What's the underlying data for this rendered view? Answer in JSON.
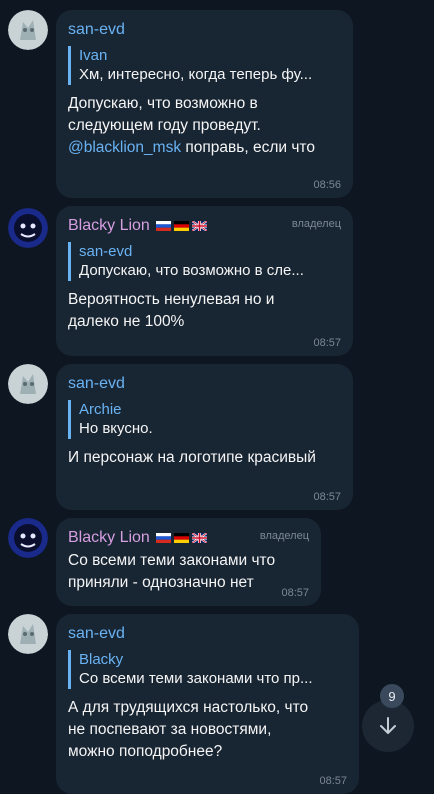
{
  "messages": [
    {
      "sender": "san-evd",
      "reply_to": "Ivan",
      "reply_text": "Хм, интересно, когда теперь фу...",
      "text_line1": "Допускаю, что возможно в",
      "text_line2": "следующем году проведут.",
      "mention": "@blacklion_msk",
      "text_line3_rest": " поправь, если что",
      "time": "08:56"
    },
    {
      "sender": "Blacky Lion",
      "role": "владелец",
      "reply_to": "san-evd",
      "reply_text": "Допускаю, что возможно в сле...",
      "text_line1": "Вероятность ненулевая но и",
      "text_line2": "далеко не 100%",
      "time": "08:57"
    },
    {
      "sender": "san-evd",
      "reply_to": "Archie",
      "reply_text": "Но вкусно.",
      "text_line1": "И персонаж на логотипе красивый",
      "time": "08:57"
    },
    {
      "sender": "Blacky Lion",
      "role": "владелец",
      "text_line1": "Со всеми теми законами что",
      "text_line2": "приняли - однозначно нет",
      "time": "08:57"
    },
    {
      "sender": "san-evd",
      "reply_to": "Blacky",
      "reply_text": "Со всеми теми законами что пр...",
      "text_line1": "А для трудящихся настолько, что",
      "text_line2": "не поспевают за новостями,",
      "text_line3": "можно поподробнее?",
      "time": "08:57"
    }
  ],
  "scroll": {
    "unread_count": "9",
    "icon": "arrow-down-icon"
  },
  "colors": {
    "background": "#0e1621",
    "bubble": "#182533",
    "accent": "#6ab3f3",
    "owner_name": "#d59ee0"
  }
}
